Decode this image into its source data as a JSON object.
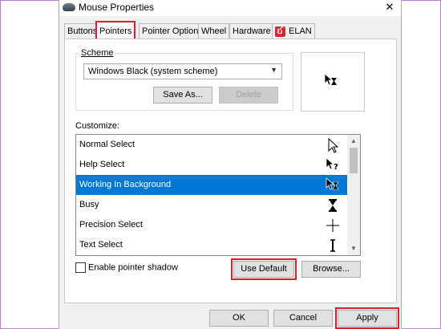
{
  "window": {
    "title": "Mouse Properties",
    "close_glyph": "✕"
  },
  "tabs": [
    {
      "label": "Buttons"
    },
    {
      "label": "Pointers"
    },
    {
      "label": "Pointer Options"
    },
    {
      "label": "Wheel"
    },
    {
      "label": "Hardware"
    },
    {
      "label": "ELAN",
      "logo_text": "ઈ"
    }
  ],
  "active_tab": "Pointers",
  "scheme": {
    "group_label": "Scheme",
    "selected_value": "Windows Black (system scheme)",
    "save_as_label": "Save As...",
    "delete_label": "Delete"
  },
  "customize": {
    "label": "Customize:",
    "items": [
      {
        "label": "Normal Select",
        "icon": "arrow-cursor-icon"
      },
      {
        "label": "Help Select",
        "icon": "help-cursor-icon"
      },
      {
        "label": "Working In Background",
        "icon": "working-cursor-icon",
        "selected": true
      },
      {
        "label": "Busy",
        "icon": "hourglass-cursor-icon"
      },
      {
        "label": "Precision Select",
        "icon": "crosshair-cursor-icon"
      },
      {
        "label": "Text Select",
        "icon": "ibeam-cursor-icon"
      }
    ]
  },
  "options": {
    "enable_shadow_label": "Enable pointer shadow",
    "enable_shadow_checked": false,
    "use_default_label": "Use Default",
    "browse_label": "Browse..."
  },
  "footer": {
    "ok_label": "OK",
    "cancel_label": "Cancel",
    "apply_label": "Apply"
  },
  "colors": {
    "highlight_red": "#d4202a",
    "selection_blue": "#0078d7"
  }
}
